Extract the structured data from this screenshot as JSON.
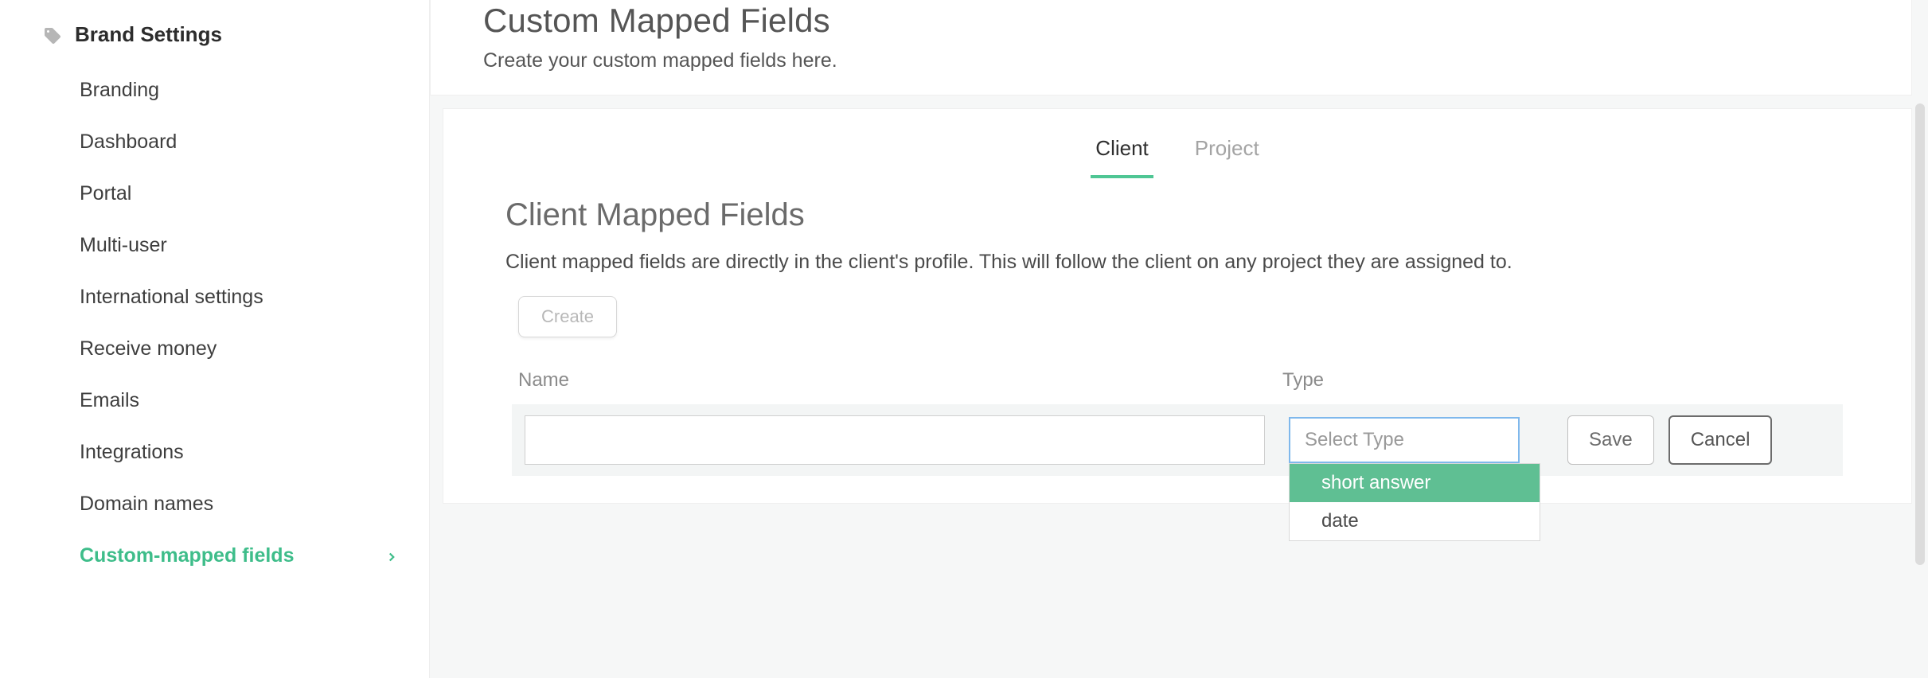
{
  "sidebar": {
    "section_label": "Brand Settings",
    "items": [
      {
        "label": "Branding"
      },
      {
        "label": "Dashboard"
      },
      {
        "label": "Portal"
      },
      {
        "label": "Multi-user"
      },
      {
        "label": "International settings"
      },
      {
        "label": "Receive money"
      },
      {
        "label": "Emails"
      },
      {
        "label": "Integrations"
      },
      {
        "label": "Domain names"
      },
      {
        "label": "Custom-mapped fields",
        "active": true
      }
    ]
  },
  "header": {
    "title": "Custom Mapped Fields",
    "subtitle": "Create your custom mapped fields here."
  },
  "tabs": {
    "client": "Client",
    "project": "Project"
  },
  "section": {
    "heading": "Client Mapped Fields",
    "desc": "Client mapped fields are directly in the client's profile. This will follow the client on any project they are assigned to.",
    "create_label": "Create",
    "col_name": "Name",
    "col_type": "Type"
  },
  "row": {
    "name_value": "",
    "type_placeholder": "Select Type",
    "options": {
      "short_answer": "short answer",
      "date": "date"
    },
    "save_label": "Save",
    "cancel_label": "Cancel"
  }
}
